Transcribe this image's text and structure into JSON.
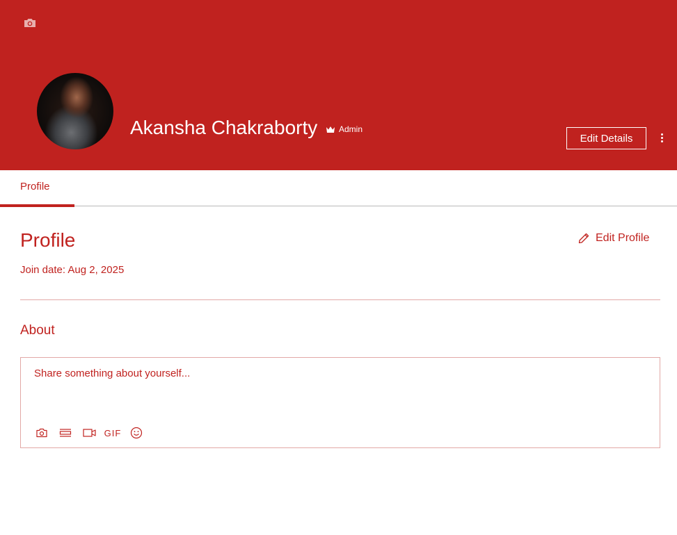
{
  "profile": {
    "name": "Akansha Chakraborty",
    "role_badge": "Admin",
    "edit_details_label": "Edit Details"
  },
  "tabs": [
    {
      "label": "Profile",
      "active": true
    }
  ],
  "section": {
    "title": "Profile",
    "edit_profile_label": "Edit Profile",
    "join_date": "Join date: Aug 2, 2025"
  },
  "about": {
    "title": "About",
    "placeholder": "Share something about yourself...",
    "toolbar": [
      {
        "icon": "camera-icon"
      },
      {
        "icon": "divider-icon"
      },
      {
        "icon": "video-icon"
      },
      {
        "icon": "gif-icon",
        "label": "GIF"
      },
      {
        "icon": "emoji-icon"
      }
    ]
  },
  "colors": {
    "brand": "#c0221f",
    "divider": "#e2a8a6",
    "background": "#ffffff"
  }
}
